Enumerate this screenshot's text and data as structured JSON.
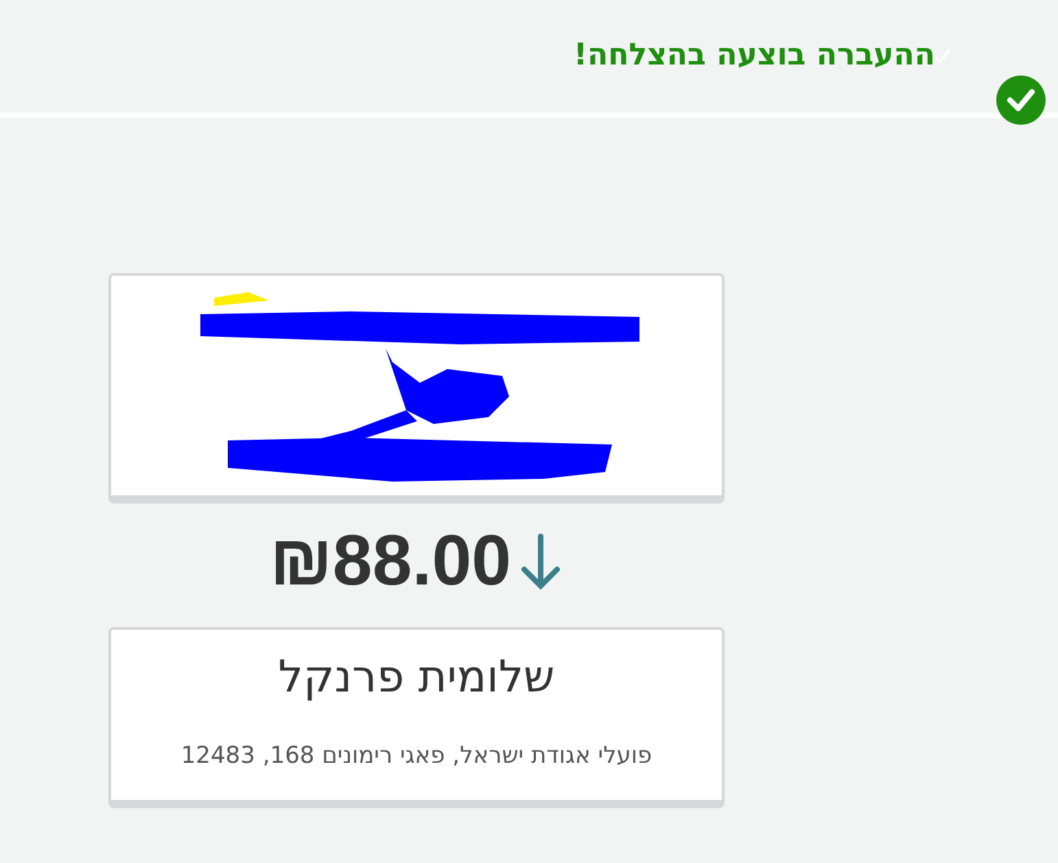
{
  "status": {
    "message": "ההעברה בוצעה בהצלחה!"
  },
  "transfer": {
    "amount": "₪88.00"
  },
  "recipient": {
    "name": "שלומית פרנקל",
    "address": "פועלי אגודת ישראל, פאגי רימונים 168, 12483"
  }
}
